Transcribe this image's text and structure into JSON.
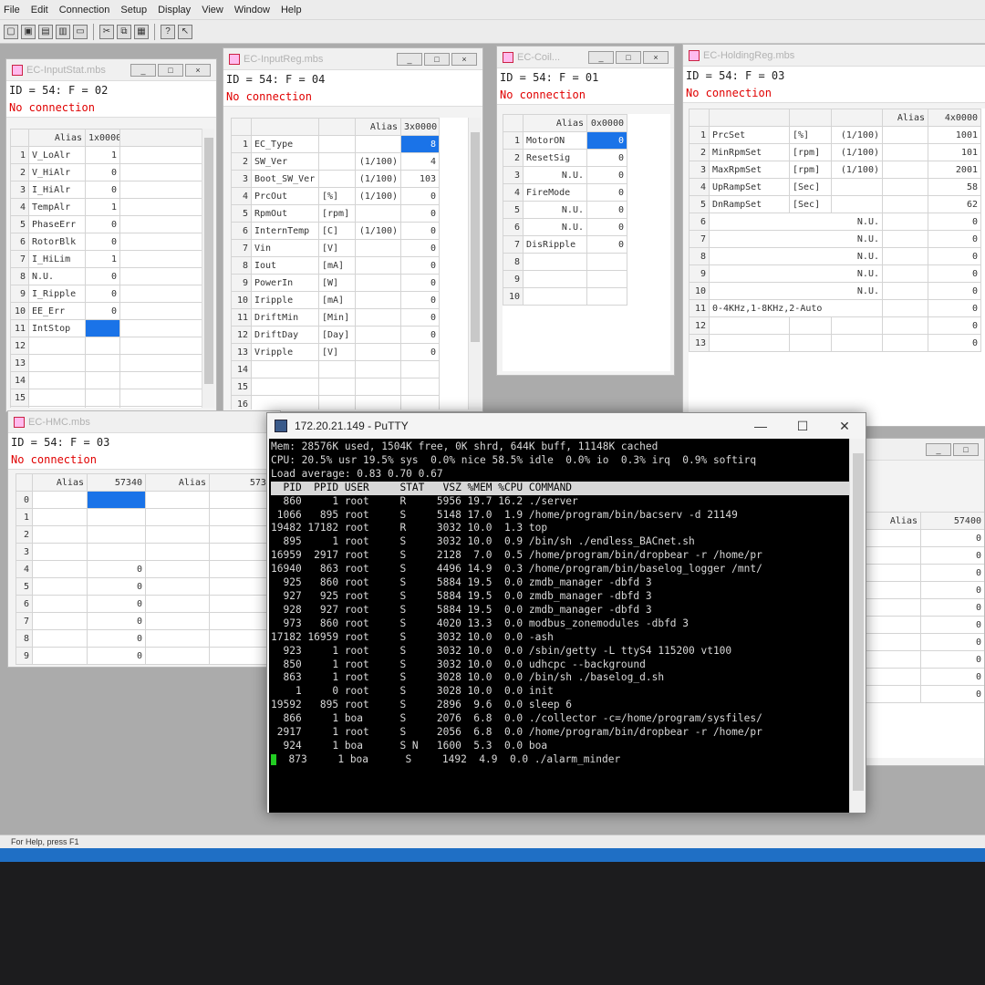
{
  "menu": [
    "File",
    "Edit",
    "Connection",
    "Setup",
    "Display",
    "View",
    "Window",
    "Help"
  ],
  "toolbar_icons": [
    "new-file-icon",
    "open-folder-icon",
    "save-icon",
    "print-icon",
    "blank-doc-icon",
    "cut-icon",
    "copy-icon",
    "paste-icon",
    "help-icon",
    "context-help-icon"
  ],
  "status_text": "For Help, press F1",
  "win_input_status": {
    "title": "EC-InputStat.mbs",
    "id_line": "ID = 54: F = 02",
    "conn": "No connection",
    "col_alias": "Alias",
    "col_addr": "1x0000",
    "rows": [
      {
        "n": "1",
        "name": "V_LoAlr",
        "val": "1"
      },
      {
        "n": "2",
        "name": "V_HiAlr",
        "val": "0"
      },
      {
        "n": "3",
        "name": "I_HiAlr",
        "val": "0"
      },
      {
        "n": "4",
        "name": "TempAlr",
        "val": "1"
      },
      {
        "n": "5",
        "name": "PhaseErr",
        "val": "0"
      },
      {
        "n": "6",
        "name": "RotorBlk",
        "val": "0"
      },
      {
        "n": "7",
        "name": "I_HiLim",
        "val": "1"
      },
      {
        "n": "8",
        "name": "N.U.",
        "val": "0"
      },
      {
        "n": "9",
        "name": "I_Ripple",
        "val": "0"
      },
      {
        "n": "10",
        "name": "EE_Err",
        "val": "0"
      },
      {
        "n": "11",
        "name": "IntStop",
        "val": ""
      },
      {
        "n": "12",
        "name": "",
        "val": ""
      },
      {
        "n": "13",
        "name": "",
        "val": ""
      },
      {
        "n": "14",
        "name": "",
        "val": ""
      },
      {
        "n": "15",
        "name": "",
        "val": ""
      },
      {
        "n": "16",
        "name": "",
        "val": ""
      }
    ]
  },
  "win_input_reg": {
    "title": "EC-InputReg.mbs",
    "id_line": "ID = 54: F = 04",
    "conn": "No connection",
    "col_alias": "Alias",
    "col_addr": "3x0000",
    "rows": [
      {
        "n": "1",
        "name": "EC_Type",
        "unit": "",
        "scale": "",
        "val": "8"
      },
      {
        "n": "2",
        "name": "SW_Ver",
        "unit": "",
        "scale": "(1/100)",
        "val": "4"
      },
      {
        "n": "3",
        "name": "Boot_SW_Ver",
        "unit": "",
        "scale": "(1/100)",
        "val": "103"
      },
      {
        "n": "4",
        "name": "PrcOut",
        "unit": "[%]",
        "scale": "(1/100)",
        "val": "0"
      },
      {
        "n": "5",
        "name": "RpmOut",
        "unit": "[rpm]",
        "scale": "",
        "val": "0"
      },
      {
        "n": "6",
        "name": "InternTemp",
        "unit": "[C]",
        "scale": "(1/100)",
        "val": "0"
      },
      {
        "n": "7",
        "name": "Vin",
        "unit": "[V]",
        "scale": "",
        "val": "0"
      },
      {
        "n": "8",
        "name": "Iout",
        "unit": "[mA]",
        "scale": "",
        "val": "0"
      },
      {
        "n": "9",
        "name": "PowerIn",
        "unit": "[W]",
        "scale": "",
        "val": "0"
      },
      {
        "n": "10",
        "name": "Iripple",
        "unit": "[mA]",
        "scale": "",
        "val": "0"
      },
      {
        "n": "11",
        "name": "DriftMin",
        "unit": "[Min]",
        "scale": "",
        "val": "0"
      },
      {
        "n": "12",
        "name": "DriftDay",
        "unit": "[Day]",
        "scale": "",
        "val": "0"
      },
      {
        "n": "13",
        "name": "Vripple",
        "unit": "[V]",
        "scale": "",
        "val": "0"
      },
      {
        "n": "14",
        "name": "",
        "unit": "",
        "scale": "",
        "val": ""
      },
      {
        "n": "15",
        "name": "",
        "unit": "",
        "scale": "",
        "val": ""
      },
      {
        "n": "16",
        "name": "",
        "unit": "",
        "scale": "",
        "val": ""
      }
    ]
  },
  "win_coil": {
    "title": "EC-Coil...",
    "id_line": "ID = 54: F = 01",
    "conn": "No connection",
    "col_alias": "Alias",
    "col_addr": "0x0000",
    "rows": [
      {
        "n": "1",
        "name": "MotorON",
        "val": "0"
      },
      {
        "n": "2",
        "name": "ResetSig",
        "val": "0"
      },
      {
        "n": "3",
        "name": "N.U.",
        "val": "0"
      },
      {
        "n": "4",
        "name": "FireMode",
        "val": "0"
      },
      {
        "n": "5",
        "name": "N.U.",
        "val": "0"
      },
      {
        "n": "6",
        "name": "N.U.",
        "val": "0"
      },
      {
        "n": "7",
        "name": "DisRipple",
        "val": "0"
      },
      {
        "n": "8",
        "name": "",
        "val": ""
      },
      {
        "n": "9",
        "name": "",
        "val": ""
      },
      {
        "n": "10",
        "name": "",
        "val": ""
      }
    ]
  },
  "win_holding": {
    "title": "EC-HoldingReg.mbs",
    "id_line": "ID = 54: F = 03",
    "conn": "No connection",
    "col_alias": "Alias",
    "col_addr": "4x0000",
    "rows": [
      {
        "n": "1",
        "name": "PrcSet",
        "unit": "[%]",
        "scale": "(1/100)",
        "val": "1001"
      },
      {
        "n": "2",
        "name": "MinRpmSet",
        "unit": "[rpm]",
        "scale": "(1/100)",
        "val": "101"
      },
      {
        "n": "3",
        "name": "MaxRpmSet",
        "unit": "[rpm]",
        "scale": "(1/100)",
        "val": "2001"
      },
      {
        "n": "4",
        "name": "UpRampSet",
        "unit": "[Sec]",
        "scale": "",
        "val": "58"
      },
      {
        "n": "5",
        "name": "DnRampSet",
        "unit": "[Sec]",
        "scale": "",
        "val": "62"
      },
      {
        "n": "6",
        "name": "N.U.",
        "unit": "",
        "scale": "",
        "val": "0"
      },
      {
        "n": "7",
        "name": "N.U.",
        "unit": "",
        "scale": "",
        "val": "0"
      },
      {
        "n": "8",
        "name": "N.U.",
        "unit": "",
        "scale": "",
        "val": "0"
      },
      {
        "n": "9",
        "name": "N.U.",
        "unit": "",
        "scale": "",
        "val": "0"
      },
      {
        "n": "10",
        "name": "N.U.",
        "unit": "",
        "scale": "",
        "val": "0"
      },
      {
        "n": "11",
        "name": "0-4KHz,1-8KHz,2-Auto",
        "unit": "",
        "scale": "",
        "val": "0"
      },
      {
        "n": "12",
        "name": "",
        "unit": "",
        "scale": "",
        "val": "0"
      },
      {
        "n": "13",
        "name": "",
        "unit": "",
        "scale": "",
        "val": "0"
      }
    ]
  },
  "win_hmc": {
    "title": "EC-HMC.mbs",
    "id_line": "ID = 54: F = 03",
    "conn": "No connection",
    "col_alias_1": "Alias",
    "col_addr_1": "57340",
    "col_alias_2": "Alias",
    "col_addr_2": "57350",
    "rows": [
      {
        "n": "0",
        "v1": "",
        "v2": ""
      },
      {
        "n": "1",
        "v1": "",
        "v2": ""
      },
      {
        "n": "2",
        "v1": "",
        "v2": ""
      },
      {
        "n": "3",
        "v1": "",
        "v2": ""
      },
      {
        "n": "4",
        "v1": "0",
        "v2": ""
      },
      {
        "n": "5",
        "v1": "0",
        "v2": ""
      },
      {
        "n": "6",
        "v1": "0",
        "v2": ""
      },
      {
        "n": "7",
        "v1": "0",
        "v2": ""
      },
      {
        "n": "8",
        "v1": "0",
        "v2": ""
      },
      {
        "n": "9",
        "v1": "0",
        "v2": ""
      }
    ]
  },
  "win_right": {
    "col_alias": "Alias",
    "col_addr": "57400",
    "rows": [
      "0",
      "0",
      "0",
      "0",
      "0",
      "0",
      "0",
      "0",
      "0",
      "0"
    ]
  },
  "putty": {
    "title": "172.20.21.149 - PuTTY",
    "lines": [
      "Mem: 28576K used, 1504K free, 0K shrd, 644K buff, 11148K cached",
      "CPU: 20.5% usr 19.5% sys  0.0% nice 58.5% idle  0.0% io  0.3% irq  0.9% softirq",
      "Load average: 0.83 0.70 0.67"
    ],
    "header": "  PID  PPID USER     STAT   VSZ %MEM %CPU COMMAND",
    "procs": [
      "  860     1 root     R     5956 19.7 16.2 ./server",
      " 1066   895 root     S     5148 17.0  1.9 /home/program/bin/bacserv -d 21149",
      "19482 17182 root     R     3032 10.0  1.3 top",
      "  895     1 root     S     3032 10.0  0.9 /bin/sh ./endless_BACnet.sh",
      "16959  2917 root     S     2128  7.0  0.5 /home/program/bin/dropbear -r /home/pr",
      "16940   863 root     S     4496 14.9  0.3 /home/program/bin/baselog_logger /mnt/",
      "  925   860 root     S     5884 19.5  0.0 zmdb_manager -dbfd 3",
      "  927   925 root     S     5884 19.5  0.0 zmdb_manager -dbfd 3",
      "  928   927 root     S     5884 19.5  0.0 zmdb_manager -dbfd 3",
      "  973   860 root     S     4020 13.3  0.0 modbus_zonemodules -dbfd 3",
      "17182 16959 root     S     3032 10.0  0.0 -ash",
      "  923     1 root     S     3032 10.0  0.0 /sbin/getty -L ttyS4 115200 vt100",
      "  850     1 root     S     3032 10.0  0.0 udhcpc --background",
      "  863     1 root     S     3028 10.0  0.0 /bin/sh ./baselog_d.sh",
      "    1     0 root     S     3028 10.0  0.0 init",
      "19592   895 root     S     2896  9.6  0.0 sleep 6",
      "  866     1 boa      S     2076  6.8  0.0 ./collector -c=/home/program/sysfiles/",
      " 2917     1 root     S     2056  6.8  0.0 /home/program/bin/dropbear -r /home/pr",
      "  924     1 boa      S N   1600  5.3  0.0 boa",
      "  873     1 boa      S     1492  4.9  0.0 ./alarm_minder"
    ]
  }
}
